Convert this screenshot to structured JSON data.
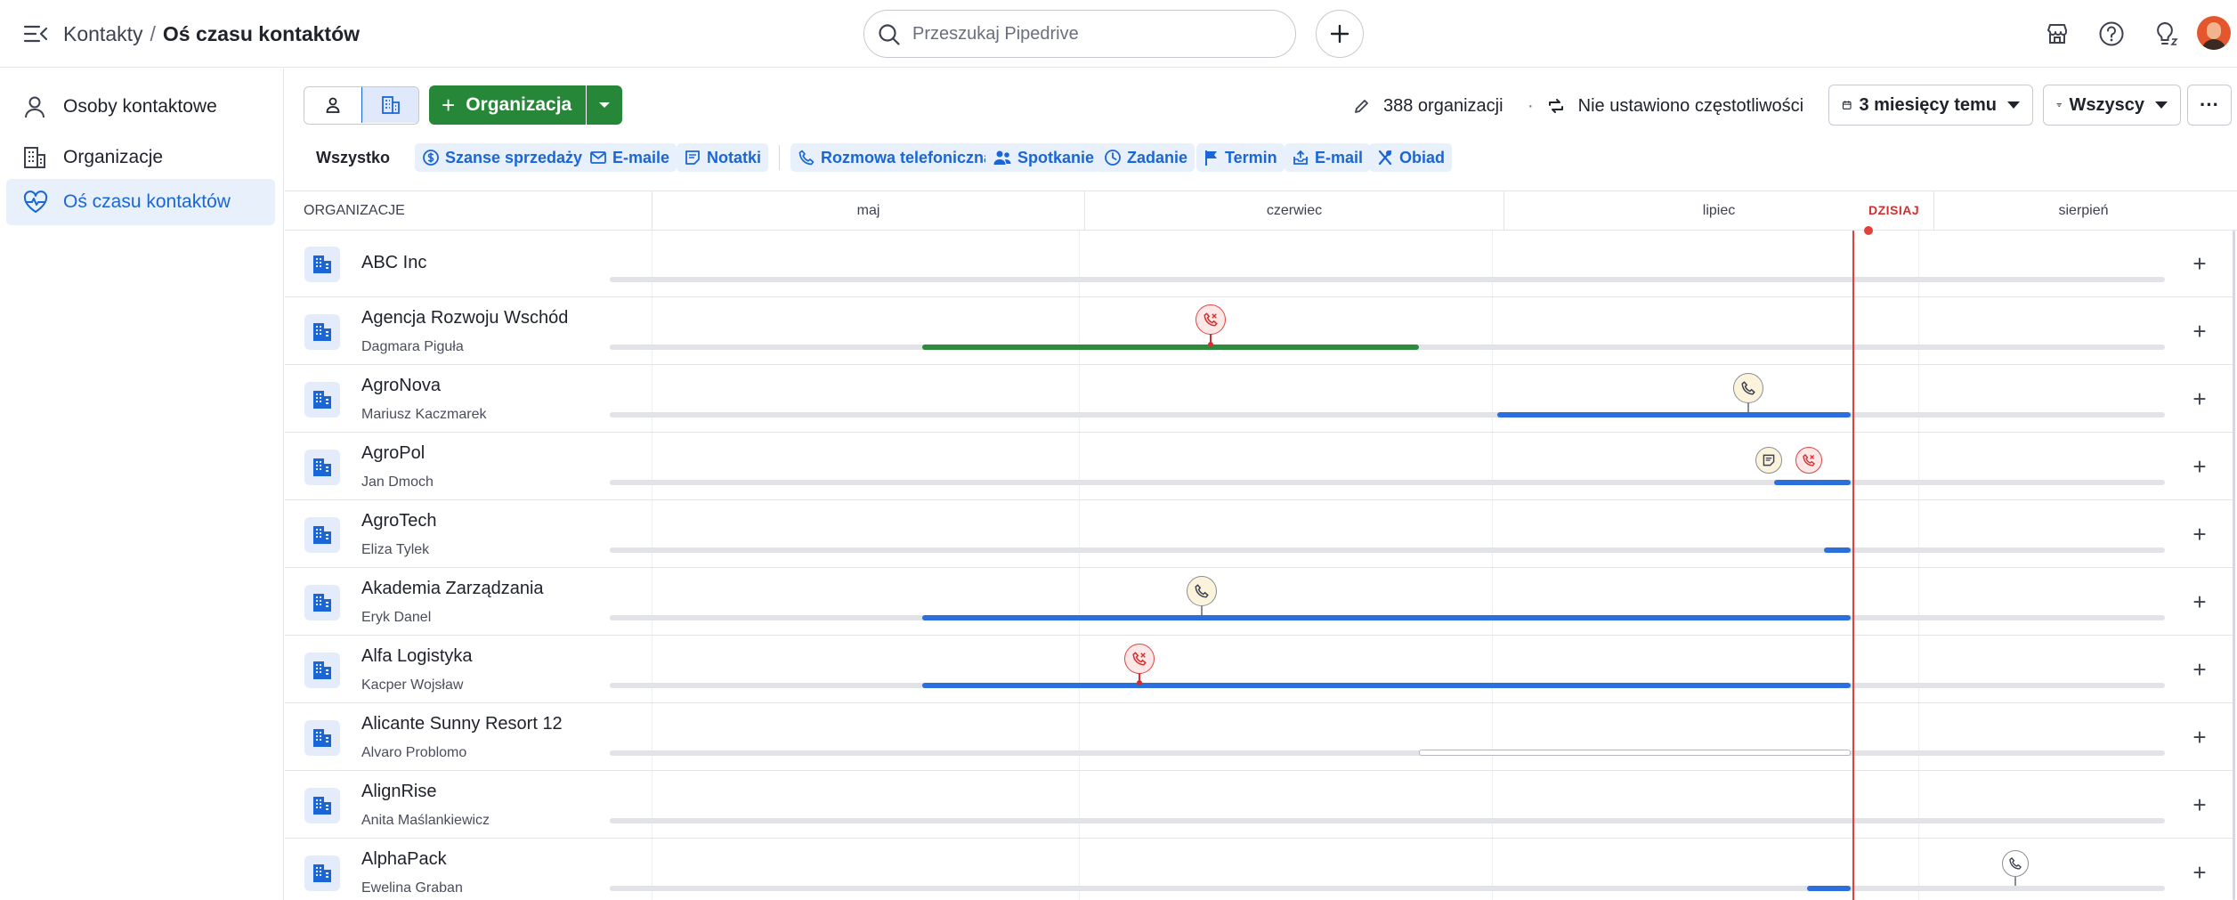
{
  "breadcrumb": {
    "root": "Kontakty",
    "separator": "/",
    "current": "Oś czasu kontaktów"
  },
  "search": {
    "placeholder": "Przeszukaj Pipedrive"
  },
  "sidebar": {
    "items": [
      {
        "label": "Osoby kontaktowe",
        "icon": "person-icon",
        "active": false
      },
      {
        "label": "Organizacje",
        "icon": "building-icon",
        "active": false
      },
      {
        "label": "Oś czasu kontaktów",
        "icon": "heart-pulse-icon",
        "active": true
      }
    ]
  },
  "toolbar": {
    "add_label": "Organizacja",
    "org_count": "388 organizacji",
    "frequency": "Nie ustawiono częstotliwości",
    "period": "3 miesięcy temu",
    "owner_filter": "Wszyscy",
    "more": "···"
  },
  "filters": {
    "all": "Wszystko",
    "deals": "Szanse sprzedaży",
    "emails": "E-maile",
    "notes": "Notatki",
    "call": "Rozmowa telefoniczna",
    "meeting": "Spotkanie",
    "task": "Zadanie",
    "deadline": "Termin",
    "email": "E-mail",
    "lunch": "Obiad"
  },
  "timeline": {
    "column_header": "ORGANIZACJE",
    "months": [
      "maj",
      "czerwiec",
      "lipiec",
      "sierpień"
    ],
    "today_label": "DZISIAJ"
  },
  "colors": {
    "accent": "#1a66d6",
    "primary_button": "#268738",
    "today": "#e0413d",
    "active_bar": "#2a6fdb",
    "deal_bar": "#2e8b3e"
  },
  "rows": [
    {
      "name": "ABC Inc",
      "contact": ""
    },
    {
      "name": "Agencja Rozwoju Wschód",
      "contact": "Dagmara Piguła"
    },
    {
      "name": "AgroNova",
      "contact": "Mariusz Kaczmarek"
    },
    {
      "name": "AgroPol",
      "contact": "Jan Dmoch"
    },
    {
      "name": "AgroTech",
      "contact": "Eliza Tylek"
    },
    {
      "name": "Akademia Zarządzania",
      "contact": "Eryk Danel"
    },
    {
      "name": "Alfa Logistyka",
      "contact": "Kacper Wojsław"
    },
    {
      "name": "Alicante Sunny Resort 12",
      "contact": "Alvaro Problomo"
    },
    {
      "name": "AlignRise",
      "contact": "Anita Maślankiewicz"
    },
    {
      "name": "AlphaPack",
      "contact": "Ewelina Graban"
    }
  ]
}
